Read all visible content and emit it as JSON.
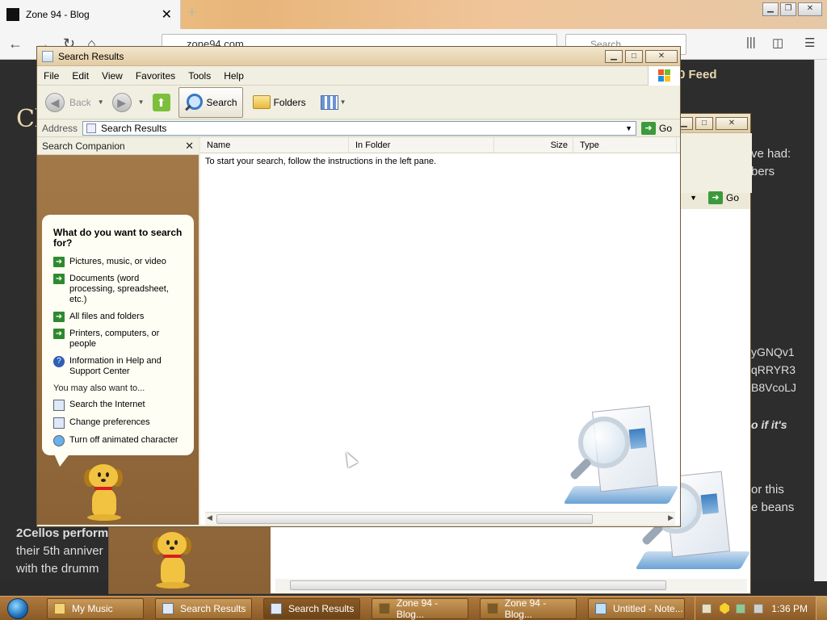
{
  "browser": {
    "tab_title": "Zone 94 - Blog",
    "url_text": "zone94.com",
    "search_placeholder": "Search"
  },
  "background_page": {
    "header_text": "0 Feed",
    "logo_fragment": "Cl",
    "snippets": [
      "ve had:",
      "bers",
      "yGNQv1",
      "qRRYR3",
      "B8VcoLJ",
      "o if it's",
      "or this",
      "e beans"
    ],
    "article": [
      "2Cellos perform",
      "their 5th anniver",
      "with the drumm"
    ]
  },
  "explorer": {
    "title": "Search Results",
    "menu": [
      "File",
      "Edit",
      "View",
      "Favorites",
      "Tools",
      "Help"
    ],
    "toolbar": {
      "back": "Back",
      "search": "Search",
      "folders": "Folders"
    },
    "address": {
      "label": "Address",
      "value": "Search Results",
      "go": "Go"
    },
    "companion": {
      "header": "Search Companion",
      "question": "What do you want to search for?",
      "options": [
        "Pictures, music, or video",
        "Documents (word processing, spreadsheet, etc.)",
        "All files and folders",
        "Printers, computers, or people",
        "Information in Help and Support Center"
      ],
      "also_label": "You may also want to...",
      "also": [
        "Search the Internet",
        "Change preferences",
        "Turn off animated character"
      ]
    },
    "columns": [
      "Name",
      "In Folder",
      "Size",
      "Type"
    ],
    "empty_message": "To start your search, follow the instructions in the left pane."
  },
  "second_window": {
    "go": "Go"
  },
  "taskbar": {
    "items": [
      {
        "label": "My Music",
        "active": false
      },
      {
        "label": "Search Results",
        "active": false
      },
      {
        "label": "Search Results",
        "active": true
      },
      {
        "label": "Zone 94 - Blog...",
        "active": false
      },
      {
        "label": "Zone 94 - Blog...",
        "active": false
      },
      {
        "label": "Untitled - Note...",
        "active": false
      }
    ],
    "clock": "1:36 PM"
  }
}
